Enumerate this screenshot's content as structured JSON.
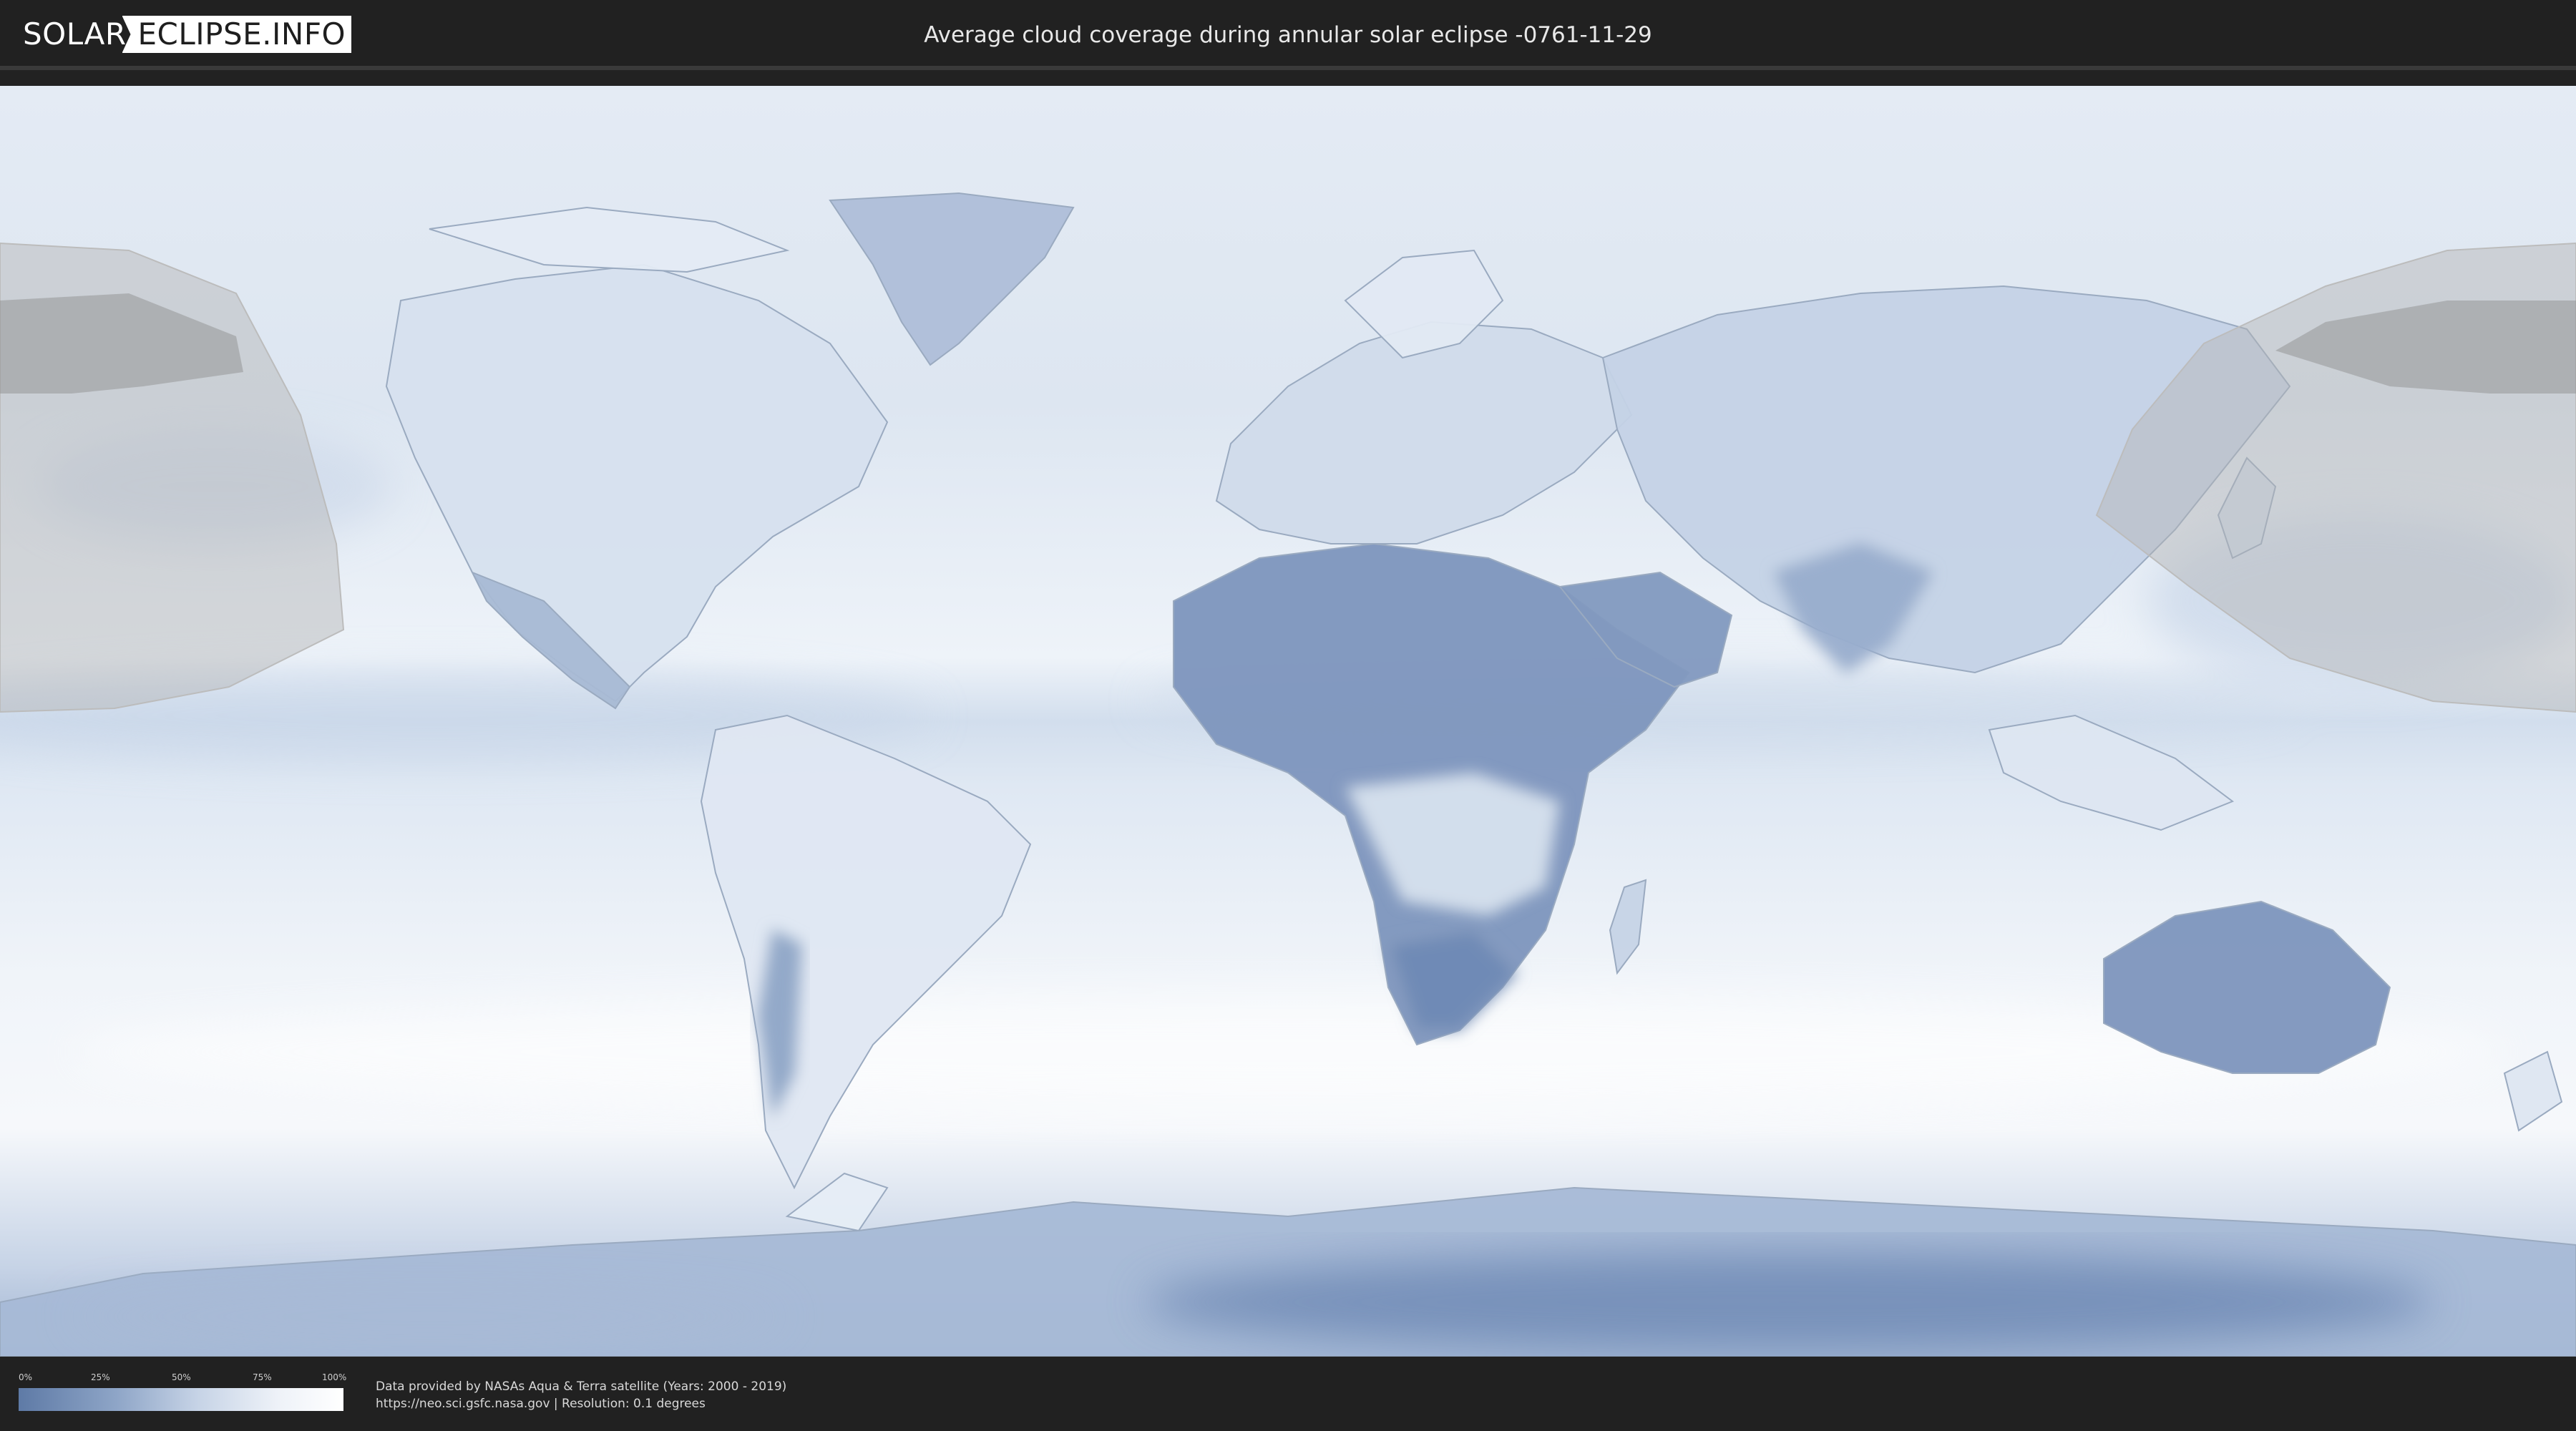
{
  "header": {
    "logo_left": "SOLAR",
    "logo_right": "ECLIPSE.INFO",
    "title": "Average cloud coverage during annular solar eclipse -0761-11-29"
  },
  "legend": {
    "ticks": [
      "0%",
      "25%",
      "50%",
      "75%",
      "100%"
    ],
    "colors": [
      "#5e7aa6",
      "#8ea5c7",
      "#c6d3e6",
      "#eef2f8",
      "#ffffff"
    ]
  },
  "credits": {
    "line1": "Data provided by NASAs Aqua & Terra satellite (Years: 2000 - 2019)",
    "line2": "https://neo.sci.gsfc.nasa.gov | Resolution: 0.1 degrees"
  },
  "map": {
    "ocean_color": "#dfe8f3",
    "low_cloud_color": "#6b86b2",
    "eclipse_shade_color": "#b4b4b4"
  }
}
